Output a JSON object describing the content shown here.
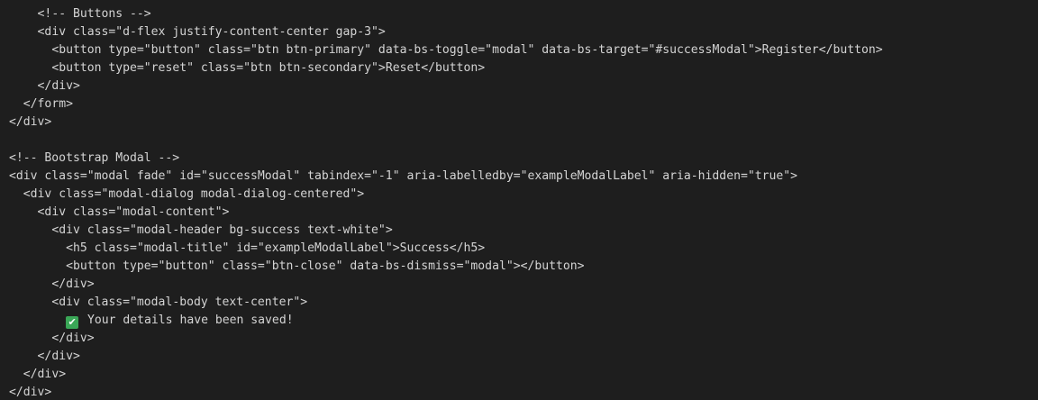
{
  "code_lines": [
    {
      "indent": "    ",
      "text": "<!-- Buttons -->"
    },
    {
      "indent": "    ",
      "text": "<div class=\"d-flex justify-content-center gap-3\">"
    },
    {
      "indent": "      ",
      "text": "<button type=\"button\" class=\"btn btn-primary\" data-bs-toggle=\"modal\" data-bs-target=\"#successModal\">Register</button>"
    },
    {
      "indent": "      ",
      "text": "<button type=\"reset\" class=\"btn btn-secondary\">Reset</button>"
    },
    {
      "indent": "    ",
      "text": "</div>"
    },
    {
      "indent": "  ",
      "text": "</form>"
    },
    {
      "indent": "",
      "text": "</div>"
    },
    {
      "indent": "",
      "text": ""
    },
    {
      "indent": "",
      "text": "<!-- Bootstrap Modal -->"
    },
    {
      "indent": "",
      "text": "<div class=\"modal fade\" id=\"successModal\" tabindex=\"-1\" aria-labelledby=\"exampleModalLabel\" aria-hidden=\"true\">"
    },
    {
      "indent": "  ",
      "text": "<div class=\"modal-dialog modal-dialog-centered\">"
    },
    {
      "indent": "    ",
      "text": "<div class=\"modal-content\">"
    },
    {
      "indent": "      ",
      "text": "<div class=\"modal-header bg-success text-white\">"
    },
    {
      "indent": "        ",
      "text": "<h5 class=\"modal-title\" id=\"exampleModalLabel\">Success</h5>"
    },
    {
      "indent": "        ",
      "text": "<button type=\"button\" class=\"btn-close\" data-bs-dismiss=\"modal\"></button>"
    },
    {
      "indent": "      ",
      "text": "</div>"
    },
    {
      "indent": "      ",
      "text": "<div class=\"modal-body text-center\">"
    },
    {
      "indent": "        ",
      "icon": "check-mark-icon",
      "text": "Your details have been saved!"
    },
    {
      "indent": "      ",
      "text": "</div>"
    },
    {
      "indent": "    ",
      "text": "</div>"
    },
    {
      "indent": "  ",
      "text": "</div>"
    },
    {
      "indent": "",
      "text": "</div>"
    }
  ],
  "colors": {
    "background": "#1e1e1e",
    "text": "#d4d4d4",
    "check_icon": "#3aa757"
  }
}
